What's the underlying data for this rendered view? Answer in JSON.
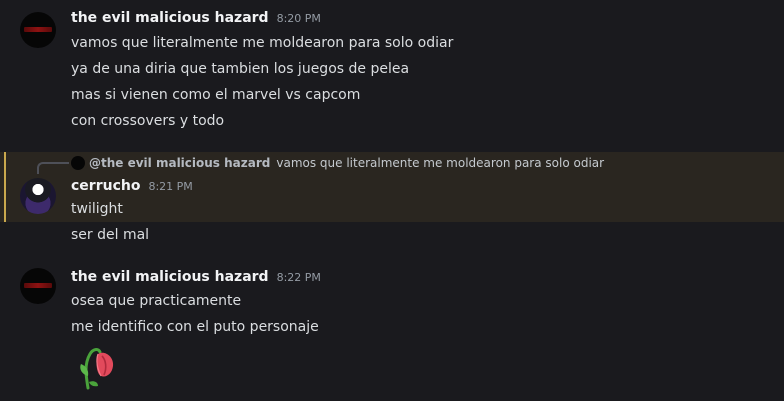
{
  "messages": [
    {
      "author": "the evil malicious hazard",
      "time": "8:20 PM",
      "lines": [
        "vamos que literalmente me moldearon para solo odiar",
        "ya de una diria que tambien los juegos de pelea",
        "mas si vienen como el marvel vs capcom",
        "con crossovers y todo"
      ]
    },
    {
      "reply": {
        "mention": "@the evil malicious hazard",
        "text": "vamos que literalmente me moldearon para solo odiar"
      },
      "author": "cerrucho",
      "time": "8:21 PM",
      "lines": [
        "twilight",
        "ser del mal"
      ]
    },
    {
      "author": "the evil malicious hazard",
      "time": "8:22 PM",
      "lines": [
        "osea que practicamente",
        "me identifico con el puto personaje"
      ],
      "emoji": "wilted-flower-emoji"
    }
  ],
  "colors": {
    "background": "#1a1a1e",
    "highlight": "#2a2620",
    "highlight_bar": "#c9a84d",
    "author": "#f2f3f5",
    "timestamp": "#949ba4",
    "text": "#dbdee1"
  }
}
